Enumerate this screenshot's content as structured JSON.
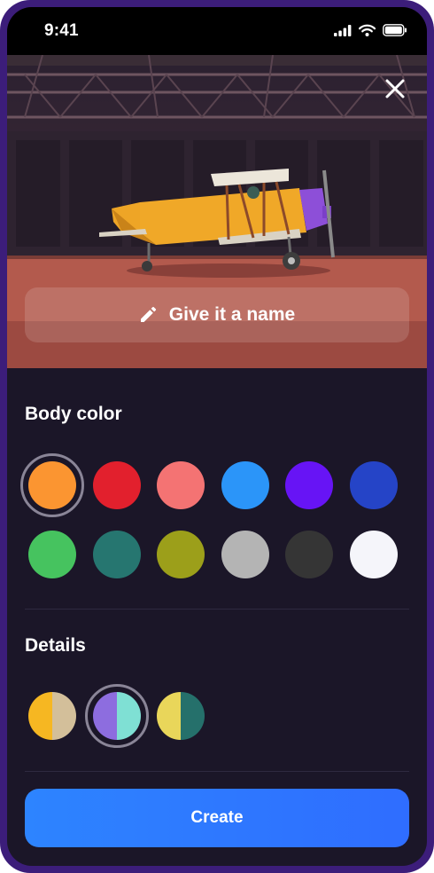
{
  "status_bar": {
    "time": "9:41",
    "icons": [
      "signal-icon",
      "wifi-icon",
      "battery-icon"
    ]
  },
  "header": {
    "close_icon": "close-icon"
  },
  "name_button": {
    "label": "Give it a name",
    "icon": "pencil-icon"
  },
  "body_color": {
    "title": "Body color",
    "selected_index": 0,
    "colors": [
      "#fb9531",
      "#e2202d",
      "#f47373",
      "#2b95f9",
      "#6714f5",
      "#2544c7",
      "#46c35f",
      "#267670",
      "#9c9f1a",
      "#b4b4b4",
      "#353535",
      "#f5f5fa"
    ]
  },
  "details": {
    "title": "Details",
    "selected_index": 1,
    "options": [
      {
        "left": "#f6b722",
        "right": "#d3bf9a"
      },
      {
        "left": "#8d6ddf",
        "right": "#7fe0d4"
      },
      {
        "left": "#e9d65a",
        "right": "#25706b"
      }
    ]
  },
  "footer": {
    "create_label": "Create"
  }
}
